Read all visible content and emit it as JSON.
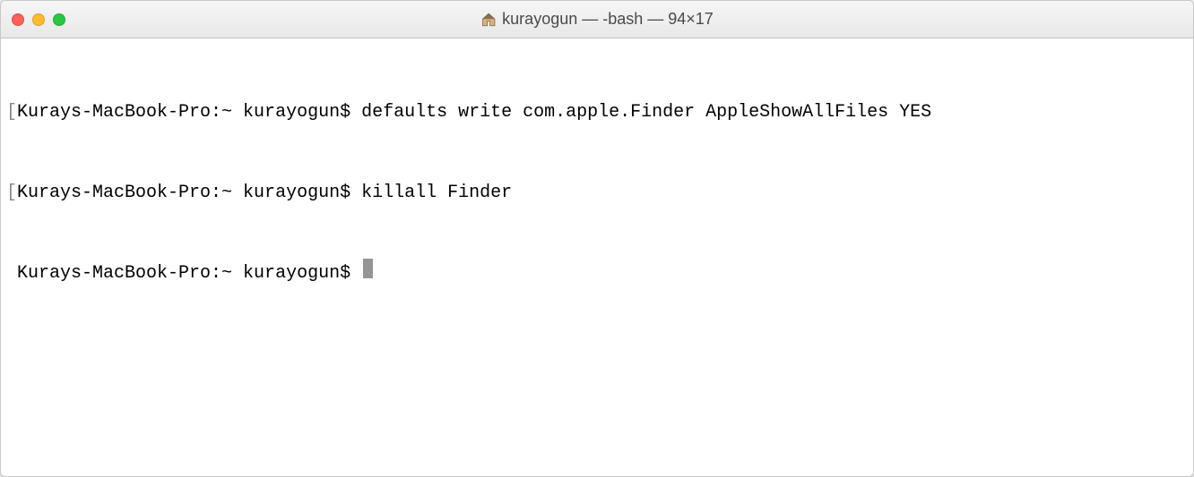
{
  "titlebar": {
    "title": "kurayogun — -bash — 94×17"
  },
  "terminal": {
    "lines": [
      {
        "bracket": "[",
        "prompt": "Kurays-MacBook-Pro:~ kurayogun$ ",
        "command": "defaults write com.apple.Finder AppleShowAllFiles YES"
      },
      {
        "bracket": "[",
        "prompt": "Kurays-MacBook-Pro:~ kurayogun$ ",
        "command": "killall Finder"
      },
      {
        "bracket": " ",
        "prompt": "Kurays-MacBook-Pro:~ kurayogun$ ",
        "command": ""
      }
    ]
  }
}
